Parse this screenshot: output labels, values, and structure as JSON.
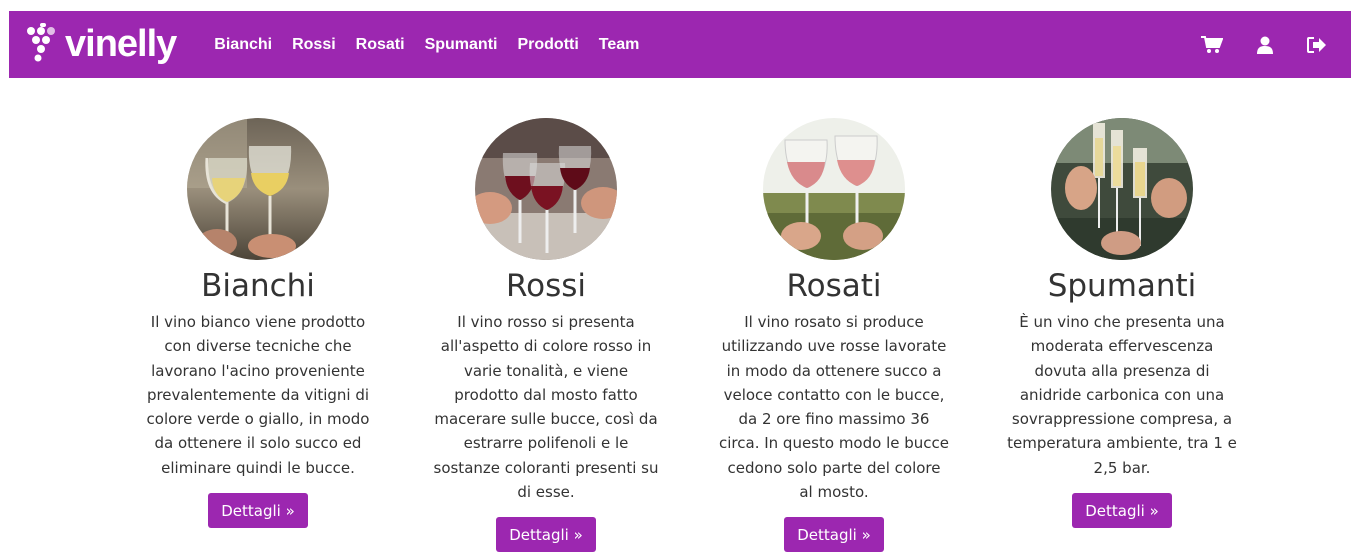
{
  "brand": {
    "name": "vinelly",
    "icon": "grape-logo-icon"
  },
  "nav": {
    "links": [
      "Bianchi",
      "Rossi",
      "Rosati",
      "Spumanti",
      "Prodotti",
      "Team"
    ],
    "icons": [
      "cart-icon",
      "user-icon",
      "logout-icon"
    ]
  },
  "colors": {
    "accent": "#9c27b0",
    "text": "#333333"
  },
  "cards": [
    {
      "title": "Bianchi",
      "description": "Il vino bianco viene prodotto con diverse tecniche che lavorano l'acino proveniente prevalentemente da vitigni di colore verde o giallo, in modo da ottenere il solo succo ed eliminare quindi le bucce.",
      "button": "Dettagli »",
      "image": "white-wine-glasses-photo"
    },
    {
      "title": "Rossi",
      "description": "Il vino rosso si presenta all'aspetto di colore rosso in varie tonalità, e viene prodotto dal mosto fatto macerare sulle bucce, così da estrarre polifenoli e le sostanze coloranti presenti su di esse.",
      "button": "Dettagli »",
      "image": "red-wine-toast-photo"
    },
    {
      "title": "Rosati",
      "description": "Il vino rosato si produce utilizzando uve rosse lavorate in modo da ottenere succo a veloce contatto con le bucce, da 2 ore fino massimo 36 circa. In questo modo le bucce cedono solo parte del colore al mosto.",
      "button": "Dettagli »",
      "image": "rose-wine-toast-photo"
    },
    {
      "title": "Spumanti",
      "description": "È un vino che presenta una moderata effervescenza dovuta alla presenza di anidride carbonica con una sovrappressione compresa, a temperatura ambiente, tra 1 e 2,5 bar.",
      "button": "Dettagli »",
      "image": "sparkling-wine-toast-photo"
    }
  ]
}
